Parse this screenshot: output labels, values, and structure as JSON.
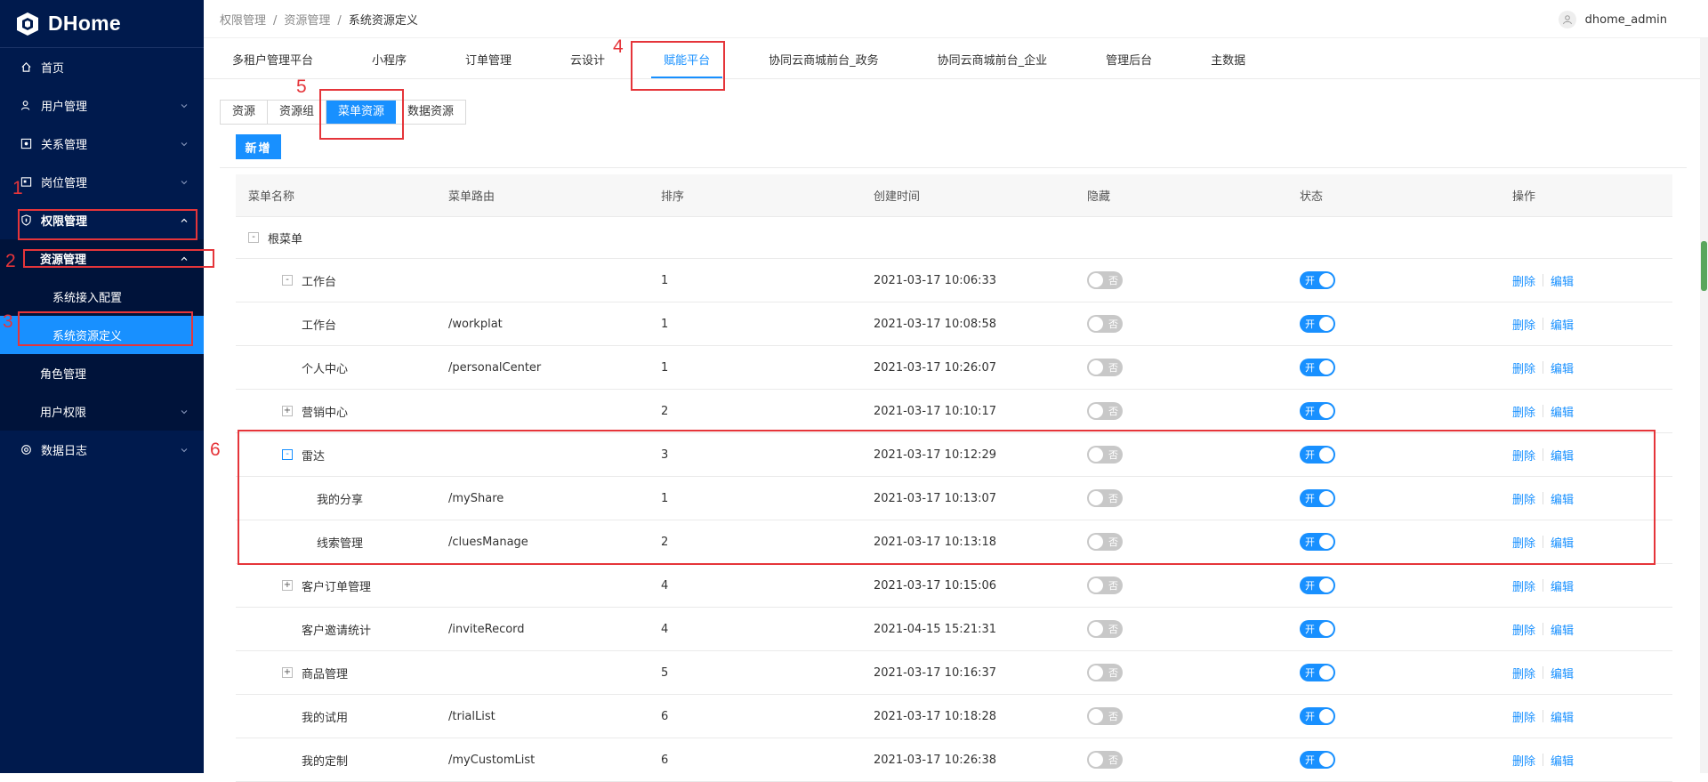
{
  "app": {
    "name": "DHome"
  },
  "sidebar": {
    "items": [
      {
        "label": "首页",
        "icon": "home-icon",
        "arrow": false
      },
      {
        "label": "用户管理",
        "icon": "user-icon",
        "arrow": "down"
      },
      {
        "label": "关系管理",
        "icon": "relation-icon",
        "arrow": "down"
      },
      {
        "label": "岗位管理",
        "icon": "post-icon",
        "arrow": "down"
      },
      {
        "label": "权限管理",
        "icon": "shield-icon",
        "arrow": "up"
      },
      {
        "label": "资源管理",
        "arrow": "up"
      },
      {
        "label": "系统接入配置"
      },
      {
        "label": "系统资源定义",
        "selected": true
      },
      {
        "label": "角色管理"
      },
      {
        "label": "用户权限",
        "arrow": "down"
      },
      {
        "label": "数据日志",
        "icon": "log-icon",
        "arrow": "down"
      }
    ]
  },
  "breadcrumb": [
    "权限管理",
    "资源管理",
    "系统资源定义"
  ],
  "user": {
    "name": "dhome_admin"
  },
  "tabs": [
    "多租户管理平台",
    "小程序",
    "订单管理",
    "云设计",
    "赋能平台",
    "协同云商城前台_政务",
    "协同云商城前台_企业",
    "管理后台",
    "主数据"
  ],
  "active_tab": "赋能平台",
  "segments": [
    "资源",
    "资源组",
    "菜单资源",
    "数据资源"
  ],
  "active_segment": "菜单资源",
  "add_button": "新增",
  "table": {
    "headers": [
      "菜单名称",
      "菜单路由",
      "排序",
      "创建时间",
      "隐藏",
      "状态",
      "操作"
    ],
    "root": {
      "toggle": "-",
      "name": "根菜单"
    },
    "hide_label": "否",
    "status_label": "开",
    "action_delete": "删除",
    "action_edit": "编辑",
    "rows": [
      {
        "toggle": "-",
        "indent": 1,
        "name": "工作台",
        "route": "",
        "sort": "1",
        "created": "2021-03-17 10:06:33"
      },
      {
        "toggle": "",
        "indent": 2,
        "name": "工作台",
        "route": "/workplat",
        "sort": "1",
        "created": "2021-03-17 10:08:58"
      },
      {
        "toggle": "",
        "indent": 2,
        "name": "个人中心",
        "route": "/personalCenter",
        "sort": "1",
        "created": "2021-03-17 10:26:07"
      },
      {
        "toggle": "+",
        "indent": 1,
        "name": "营销中心",
        "route": "",
        "sort": "2",
        "created": "2021-03-17 10:10:17"
      },
      {
        "toggle": "-",
        "indent": 1,
        "blue": true,
        "name": "雷达",
        "route": "",
        "sort": "3",
        "created": "2021-03-17 10:12:29"
      },
      {
        "toggle": "",
        "indent": 3,
        "name": "我的分享",
        "route": "/myShare",
        "sort": "1",
        "created": "2021-03-17 10:13:07"
      },
      {
        "toggle": "",
        "indent": 3,
        "name": "线索管理",
        "route": "/cluesManage",
        "sort": "2",
        "created": "2021-03-17 10:13:18"
      },
      {
        "toggle": "+",
        "indent": 1,
        "name": "客户订单管理",
        "route": "",
        "sort": "4",
        "created": "2021-03-17 10:15:06"
      },
      {
        "toggle": "",
        "indent": 2,
        "name": "客户邀请统计",
        "route": "/inviteRecord",
        "sort": "4",
        "created": "2021-04-15 15:21:31"
      },
      {
        "toggle": "+",
        "indent": 1,
        "name": "商品管理",
        "route": "",
        "sort": "5",
        "created": "2021-03-17 10:16:37"
      },
      {
        "toggle": "",
        "indent": 2,
        "name": "我的试用",
        "route": "/trialList",
        "sort": "6",
        "created": "2021-03-17 10:18:28"
      },
      {
        "toggle": "",
        "indent": 2,
        "name": "我的定制",
        "route": "/myCustomList",
        "sort": "6",
        "created": "2021-03-17 10:26:38"
      }
    ]
  },
  "annotations": [
    "1",
    "2",
    "3",
    "4",
    "5",
    "6"
  ],
  "colors": {
    "sidebar": "#001a4d",
    "accent": "#1890ff",
    "annotation": "#e5353a"
  }
}
